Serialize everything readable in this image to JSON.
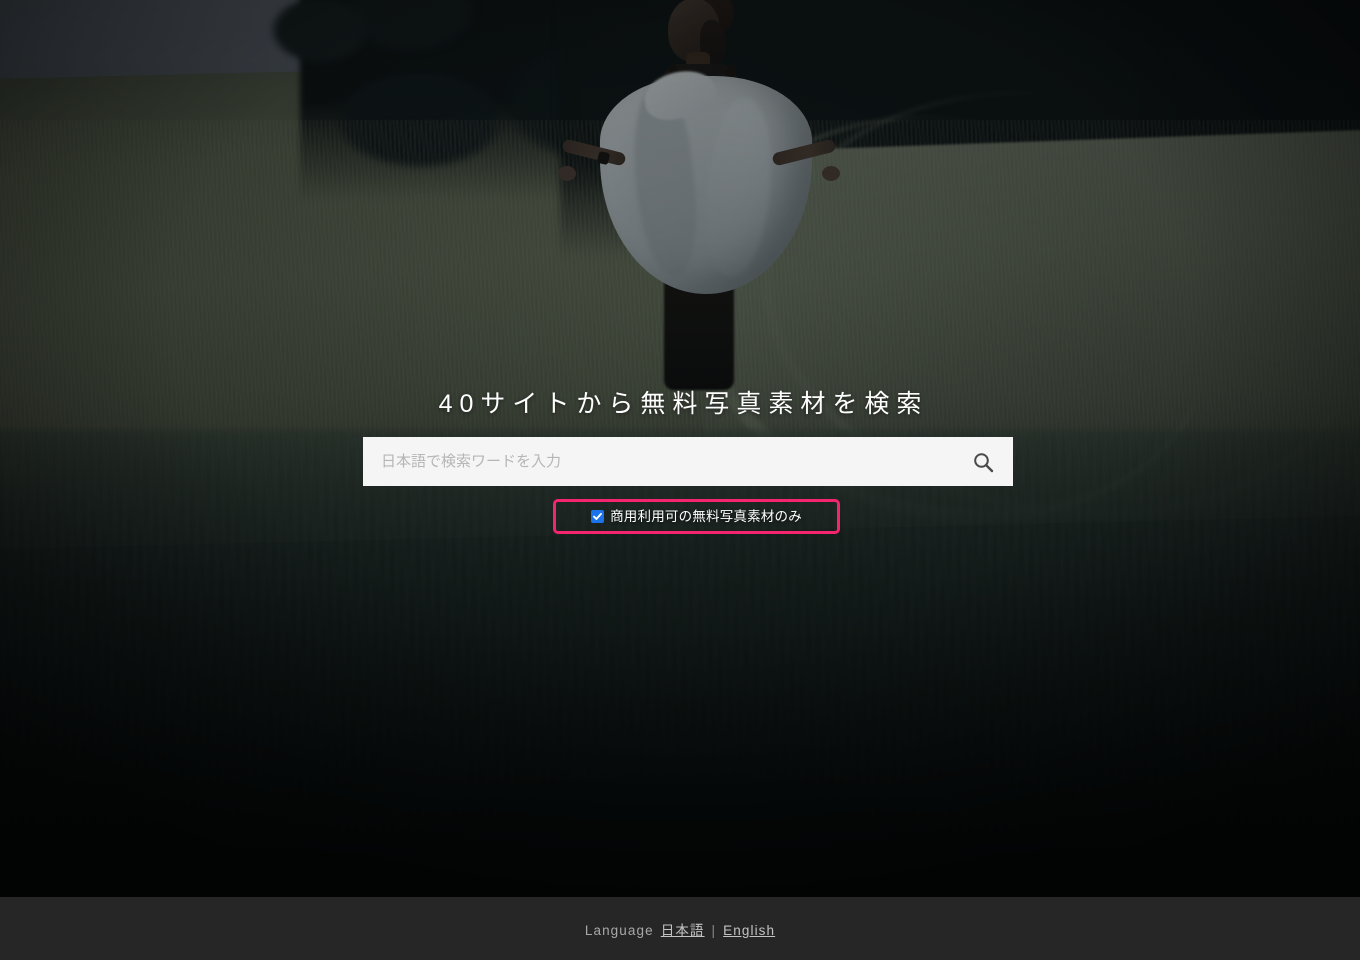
{
  "page": {
    "title": "40サイトから無料写真素材を検索"
  },
  "hero": {
    "headline": "40サイトから無料写真素材を検索",
    "background_image_alt": "夕暮れの麦畑を歩く白いショールの女性",
    "overlay_tint": "#1e2e30"
  },
  "search": {
    "placeholder": "日本語で検索ワードを入力",
    "value": "",
    "button_icon": "search-icon",
    "field_background": "#f5f5f5",
    "placeholder_color": "#b6b6b6"
  },
  "filter": {
    "checkbox_checked": true,
    "checkbox_color": "#1a73e8",
    "label": "商用利用可の無料写真素材のみ",
    "highlight_border_color": "#f5246e"
  },
  "footer": {
    "background": "#262626",
    "language_label": "Language",
    "links": [
      {
        "label": "日本語"
      },
      {
        "label": "English"
      }
    ],
    "separator": "|"
  }
}
